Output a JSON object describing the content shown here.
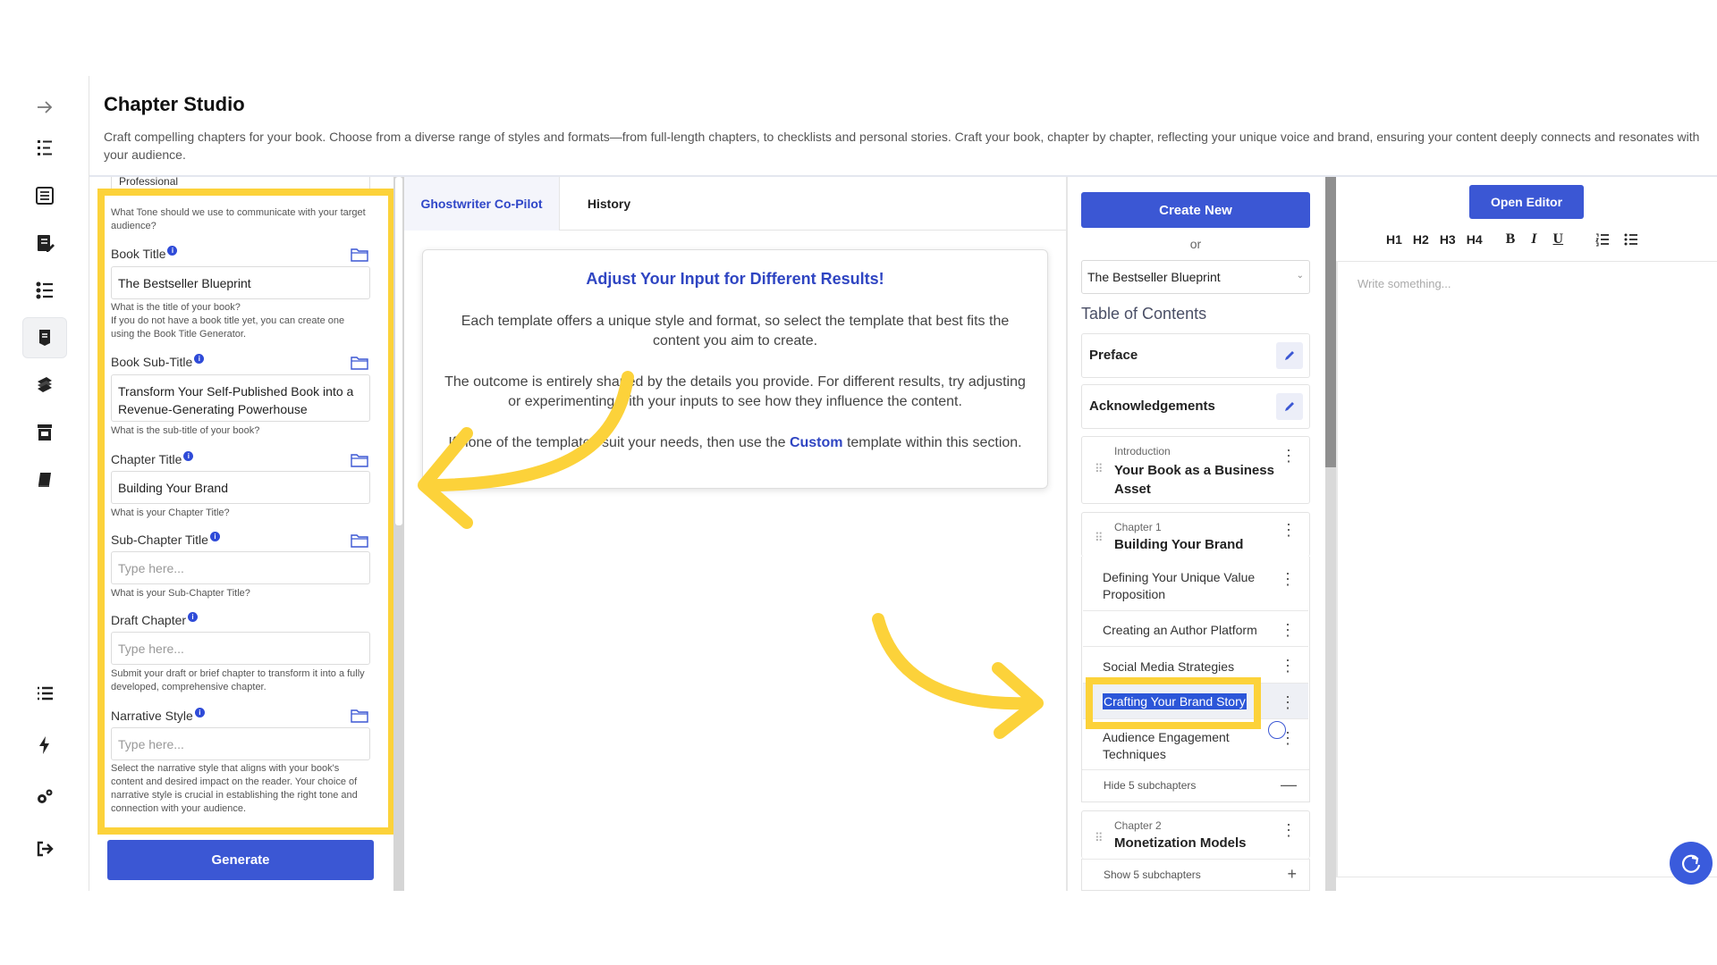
{
  "header": {
    "title": "Chapter Studio",
    "description": "Craft compelling chapters for your book. Choose from a diverse range of styles and formats—from full-length chapters, to checklists and personal stories. Craft your book, chapter by chapter, reflecting your unique voice and brand, ensuring your content deeply connects and resonates with your audience."
  },
  "rail": {
    "icons": [
      "collapse-arrow-icon",
      "outline-list-icon",
      "book-content-icon",
      "edit-document-icon",
      "numbered-list-icon",
      "chapter-studio-icon",
      "books-stack-icon",
      "archive-icon",
      "book-icon",
      "list-icon",
      "lightning-icon",
      "settings-gears-icon",
      "logout-icon"
    ]
  },
  "form": {
    "tone_value_stub": "Professional",
    "tone_hint": "What Tone should we use to communicate with your target audience?",
    "book_title": {
      "label": "Book Title",
      "value": "The Bestseller Blueprint",
      "hint": "What is the title of your book?\nIf you do not have a book title yet, you can create one using the Book Title Generator."
    },
    "book_subtitle": {
      "label": "Book Sub-Title",
      "value": "Transform Your Self-Published Book into a Revenue-Generating Powerhouse",
      "hint": "What is the sub-title of your book?"
    },
    "chapter_title": {
      "label": "Chapter Title",
      "value": "Building Your Brand",
      "hint": "What is your Chapter Title?"
    },
    "subchapter_title": {
      "label": "Sub-Chapter Title",
      "placeholder": "Type here...",
      "hint": "What is your Sub-Chapter Title?"
    },
    "draft_chapter": {
      "label": "Draft Chapter",
      "placeholder": "Type here...",
      "hint": "Submit your draft or brief chapter to transform it into a fully developed, comprehensive chapter."
    },
    "narrative_style": {
      "label": "Narrative Style",
      "placeholder": "Type here...",
      "hint": "Select the narrative style that aligns with your book's content and desired impact on the reader. Your choice of narrative style is crucial in establishing the right tone and connection with your audience."
    },
    "info_mark": "i",
    "generate_label": "Generate"
  },
  "middle": {
    "tabs": [
      {
        "label": "Ghostwriter Co-Pilot",
        "active": true
      },
      {
        "label": "History",
        "active": false
      }
    ],
    "card_title": "Adjust Your Input for Different Results!",
    "para1": "Each template offers a unique style and format, so select the template that best fits the content you aim to create.",
    "para2": "The outcome is entirely shaped by the details you provide. For different results, try adjusting or experimenting with your inputs to see how they influence the content.",
    "para3_pre": "If none of the templates suit your needs, then use the ",
    "para3_link": "Custom",
    "para3_post": " template within this section."
  },
  "toc": {
    "create_label": "Create New",
    "or_label": "or",
    "book_select": "The Bestseller Blueprint",
    "heading": "Table of Contents",
    "preface": "Preface",
    "acknowledgements": "Acknowledgements",
    "intro_kicker": "Introduction",
    "intro_title": "Your Book as a Business Asset",
    "ch1_kicker": "Chapter 1",
    "ch1_title": "Building Your Brand",
    "ch1_subs": [
      "Defining Your Unique Value Proposition",
      "Creating an Author Platform",
      "Social Media Strategies",
      "Crafting Your Brand Story",
      "Audience Engagement Techniques"
    ],
    "ch1_toggle": "Hide 5 subchapters",
    "ch2_kicker": "Chapter 2",
    "ch2_title": "Monetization Models",
    "ch2_toggle": "Show 5 subchapters"
  },
  "editor": {
    "open_label": "Open Editor",
    "toolbar": [
      "H1",
      "H2",
      "H3",
      "H4",
      "B",
      "I",
      "U"
    ],
    "placeholder": "Write something..."
  },
  "colors": {
    "accent": "#3b57d4",
    "highlight": "#fcd23a",
    "link": "#2f45c2"
  }
}
